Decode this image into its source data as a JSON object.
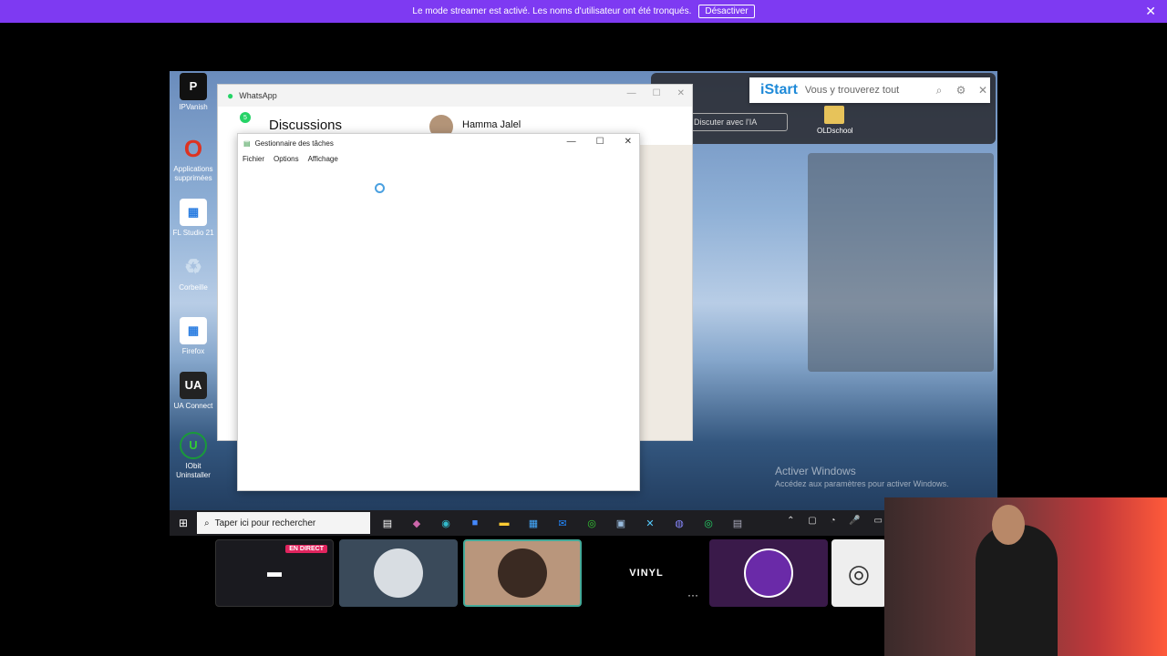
{
  "banner": {
    "message": "Le mode streamer est activé. Les noms d'utilisateur ont été tronqués.",
    "button": "Désactiver",
    "close": "✕"
  },
  "desktop": {
    "icons": [
      {
        "label": "IPVanish",
        "glyph": "P",
        "color": "#111"
      },
      {
        "label": "Applications supprimées",
        "glyph": "O",
        "color": "#d32"
      },
      {
        "label": "FL Studio 21",
        "glyph": "▦",
        "color": "#2a7de1"
      },
      {
        "label": "Corbeille",
        "glyph": "♻",
        "color": "#7ab"
      },
      {
        "label": "Firefox",
        "glyph": "▦",
        "color": "#2a7de1"
      },
      {
        "label": "UA Connect",
        "glyph": "UA",
        "color": "#222"
      },
      {
        "label": "IObit Uninstaller",
        "glyph": "U",
        "color": "#1a9a3a"
      }
    ],
    "folder_label": "OLDschool",
    "ai_button": "Discuter avec l'IA",
    "watermark_title": "Activer Windows",
    "watermark_sub": "Accédez aux paramètres pour activer Windows."
  },
  "whatsapp": {
    "title": "WhatsApp",
    "badge": "5",
    "discussions": "Discussions",
    "contact": "Hamma Jalel"
  },
  "taskmanager": {
    "title": "Gestionnaire des tâches",
    "menu": [
      "Fichier",
      "Options",
      "Affichage"
    ]
  },
  "istart": {
    "logo": "iStart",
    "placeholder": "Vous y trouverez tout"
  },
  "taskbar": {
    "search_placeholder": "Taper ici pour rechercher",
    "tray": "⌃ ▢ ◔ 🎤 ▭"
  },
  "tiles": {
    "live": "EN DIRECT",
    "vinyl": "VINYL",
    "more": "···"
  }
}
